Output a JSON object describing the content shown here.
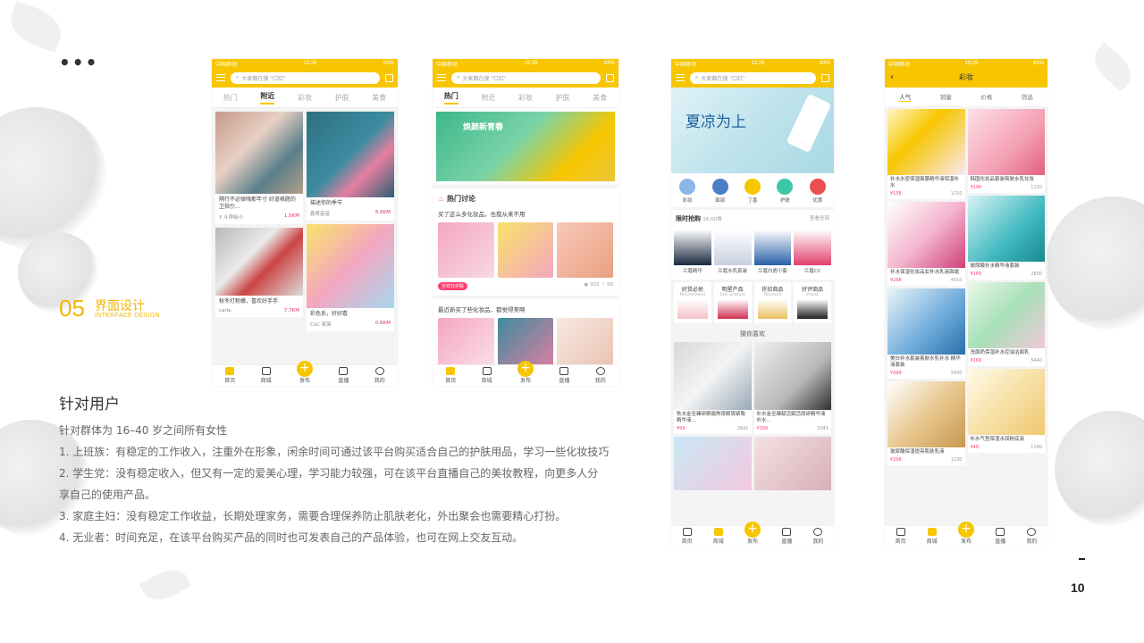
{
  "header": {
    "dots": "•••"
  },
  "section": {
    "number": "05",
    "title": "界面设计",
    "subtitle": "INTERFACE DESIGN"
  },
  "users": {
    "title": "针对用户",
    "lines": [
      "针对群体为 16–40 岁之间所有女性",
      "1.  上班族：有稳定的工作收入，注重外在形象，闲余时间可通过该平台购买适合自己的护肤用品，学习一些化妆技巧",
      "2.  学生党：没有稳定收入，但又有一定的爱美心理，学习能力较强，可在该平台直播自己的美妆教程，向更多人分",
      "享自己的使用产品。",
      "3.  家庭主妇：没有稳定工作收益，长期处理家务，需要合理保养防止肌肤老化，外出聚会也需要精心打扮。",
      "4.  无业者：时间充足，在该平台购买产品的同时也可发表自己的产品体验，也可在网上交友互动。"
    ]
  },
  "page": {
    "number": "10"
  },
  "status": {
    "carrier": "中国移动",
    "time": "15:26",
    "battery": "83%"
  },
  "search": {
    "placeholder": "大家都在搜 \"口红\""
  },
  "tabs": [
    "热门",
    "附近",
    "彩妆",
    "护肤",
    "美食"
  ],
  "nav": [
    "首页",
    "商城",
    "发布",
    "直播",
    "我的"
  ],
  "phone1": {
    "cards_left": [
      {
        "title": "隔行不必弹嗨那年寸 好道格题的卫指引...",
        "user": "Y 斗呼吸小",
        "likes": "1.5KM"
      },
      {
        "title": "秋冬打粉嫩，喜欢好手手",
        "user": "carla",
        "likes": "7.7KM"
      }
    ],
    "cards_right": [
      {
        "title": "描述你的季节",
        "user": "鑫哥苗苗",
        "likes": "5.6KM"
      },
      {
        "title": "彩色系，好好看",
        "user": "CoC 笑笑",
        "likes": "0.6KM"
      }
    ]
  },
  "phone2": {
    "banner": "焕颜新青春",
    "section": "热门讨论",
    "q1": "买了这么多化妆品，也我从来不用",
    "pill": "吉祥日护肤",
    "stats": {
      "views": "302",
      "likes": "56"
    },
    "q2": "最近新买了些化妆品，都觉得美啊"
  },
  "phone3": {
    "banner": "夏凉为上",
    "categories": [
      "彩妆",
      "面部",
      "丁香",
      "护肤",
      "优惠"
    ],
    "flash": {
      "title": "限时抢购",
      "time": "16:00场",
      "more": "查看全部"
    },
    "flash_items": [
      "兰蔻精华",
      "兰蔻水乳套装",
      "兰蔻白瓷小套",
      "兰蔻CC"
    ],
    "blocks": [
      {
        "title": "好货必抢",
        "sub": "Recommend"
      },
      {
        "title": "明星产品",
        "sub": "Star product"
      },
      {
        "title": "折扣商品",
        "sub": "Discount"
      },
      {
        "title": "好评商品",
        "sub": "Praise"
      }
    ],
    "guess": "猜你喜欢",
    "products": [
      {
        "title": "秋水金至臻研眼霜熬夜眼周紧致精华液...",
        "price": "¥99",
        "sold": "2641"
      },
      {
        "title": "补水金至臻赋活赋活原研精华液补水...",
        "price": "¥169",
        "sold": "2041"
      }
    ]
  },
  "phone4": {
    "title": "彩妆",
    "filters": [
      "人气",
      "销量",
      "价格",
      "筛选"
    ],
    "products": [
      {
        "title": "补水水密保湿面膜精华液保湿补水",
        "price": "¥158",
        "sold": "1210"
      },
      {
        "title": "韩国化妆品套装爽肤水乳化妆",
        "price": "¥199",
        "sold": "1210"
      },
      {
        "title": "补水保湿化妆品女补水乳液面霜",
        "price": "¥268",
        "sold": "4010"
      },
      {
        "title": "玻尿酸补水精华液套装",
        "price": "¥169",
        "sold": "2800"
      },
      {
        "title": "美白补水套装爽肤水乳补水 精华液套装",
        "price": "¥399",
        "sold": "2500"
      },
      {
        "title": "洗面奶保湿补水控油洁面乳",
        "price": "¥169",
        "sold": "5440"
      },
      {
        "title": "玻尿酸保湿提亮肌肤乳液",
        "price": "¥268",
        "sold": "1230"
      },
      {
        "title": "补水气垫保湿水润粉底液",
        "price": "¥48",
        "sold": "1160"
      }
    ]
  }
}
